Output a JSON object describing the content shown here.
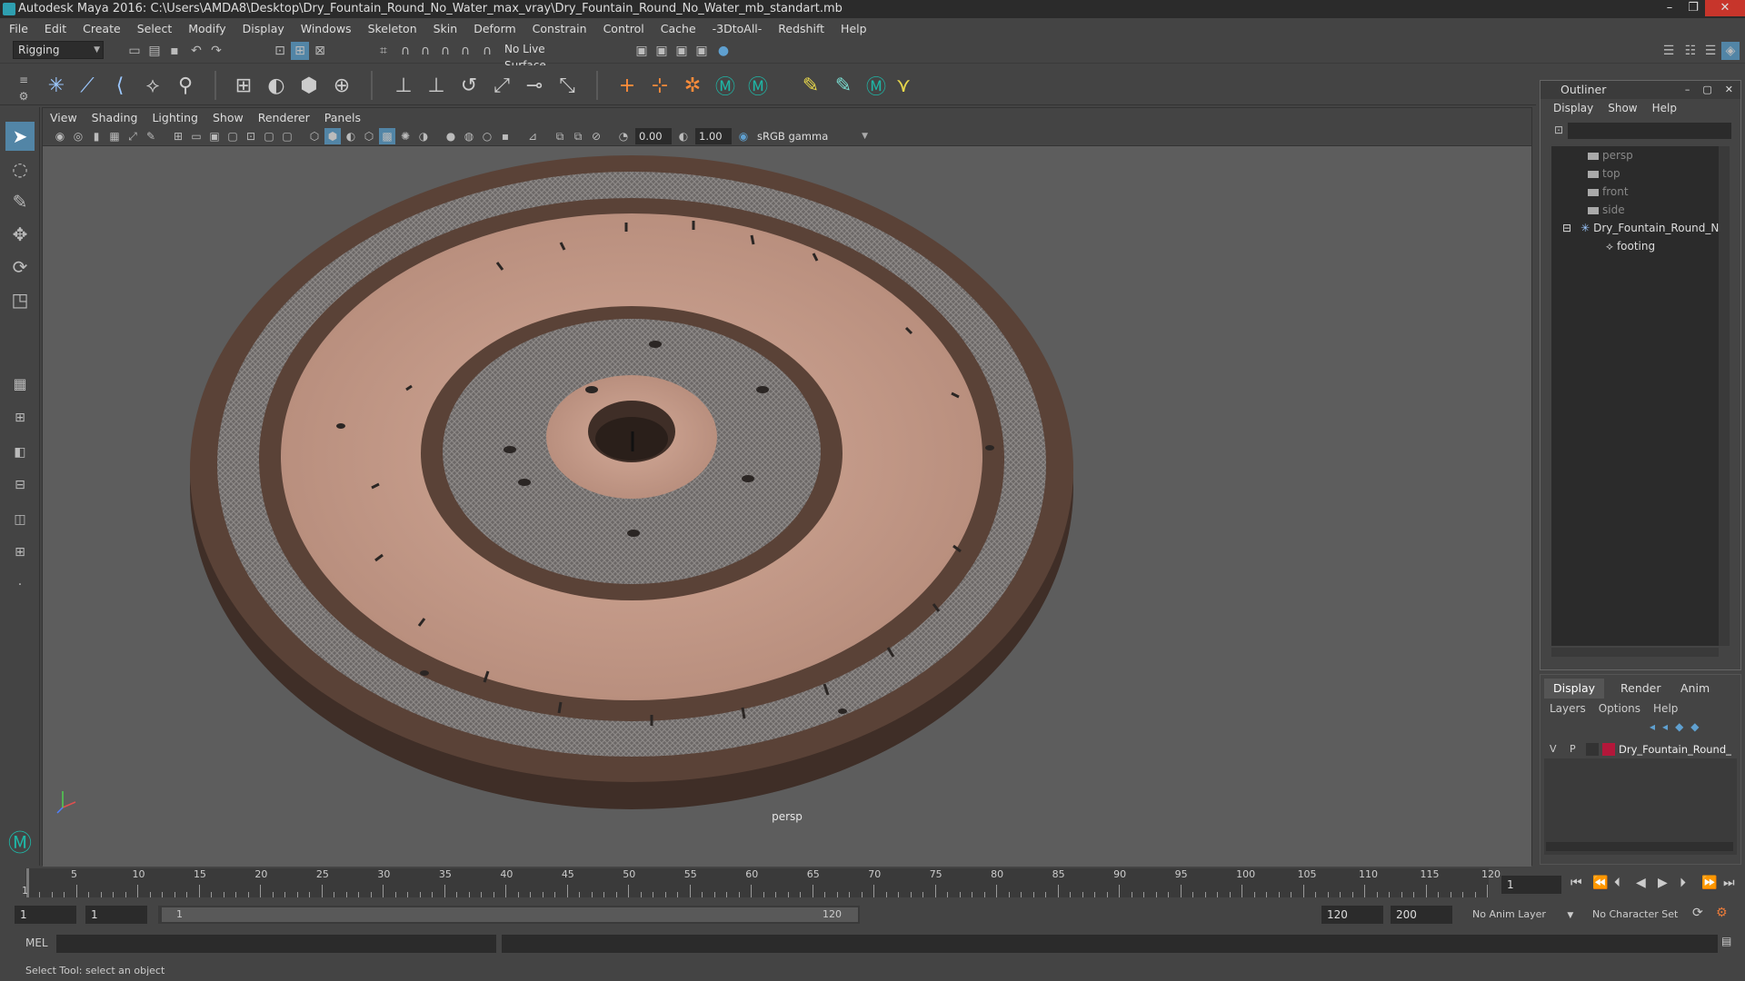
{
  "titlebar": {
    "title": "Autodesk Maya 2016: C:\\Users\\AMDA8\\Desktop\\Dry_Fountain_Round_No_Water_max_vray\\Dry_Fountain_Round_No_Water_mb_standart.mb"
  },
  "menubar": {
    "items": [
      "File",
      "Edit",
      "Create",
      "Select",
      "Modify",
      "Display",
      "Windows",
      "Skeleton",
      "Skin",
      "Deform",
      "Constrain",
      "Control",
      "Cache",
      "-3DtoAll-",
      "Redshift",
      "Help"
    ]
  },
  "statusline": {
    "mode": "Rigging",
    "live_surface": "No Live Surface"
  },
  "panel": {
    "menu": [
      "View",
      "Shading",
      "Lighting",
      "Show",
      "Renderer",
      "Panels"
    ],
    "exposure": "0.00",
    "gamma": "1.00",
    "colorspace": "sRGB gamma",
    "camera_label": "persp"
  },
  "outliner": {
    "title": "Outliner",
    "menu": [
      "Display",
      "Show",
      "Help"
    ],
    "items": [
      {
        "label": "persp",
        "type": "camera"
      },
      {
        "label": "top",
        "type": "camera"
      },
      {
        "label": "front",
        "type": "camera"
      },
      {
        "label": "side",
        "type": "camera"
      },
      {
        "label": "Dry_Fountain_Round_No",
        "type": "group"
      },
      {
        "label": "footing",
        "type": "mesh"
      }
    ]
  },
  "layers": {
    "tabs": [
      "Display",
      "Render",
      "Anim"
    ],
    "menu": [
      "Layers",
      "Options",
      "Help"
    ],
    "layer": {
      "v": "V",
      "p": "P",
      "name": "Dry_Fountain_Round_",
      "color": "#b3173a"
    }
  },
  "timeline": {
    "ticks": [
      "5",
      "10",
      "15",
      "20",
      "25",
      "30",
      "35",
      "40",
      "45",
      "50",
      "55",
      "60",
      "65",
      "70",
      "75",
      "80",
      "85",
      "90",
      "95",
      "100",
      "105",
      "110",
      "115",
      "120"
    ],
    "start_label": "1",
    "current_frame": "1"
  },
  "range": {
    "start": "1",
    "playback_start": "1",
    "slider_start": "1",
    "slider_end": "120",
    "playback_end": "120",
    "end": "200",
    "anim_layer": "No Anim Layer",
    "character_set": "No Character Set"
  },
  "mel": {
    "label": "MEL"
  },
  "helpline": {
    "text": "Select Tool: select an object"
  },
  "colors": {
    "bg": "#444444",
    "viewport": "#5d5d5d",
    "accent": "#5285a6"
  }
}
